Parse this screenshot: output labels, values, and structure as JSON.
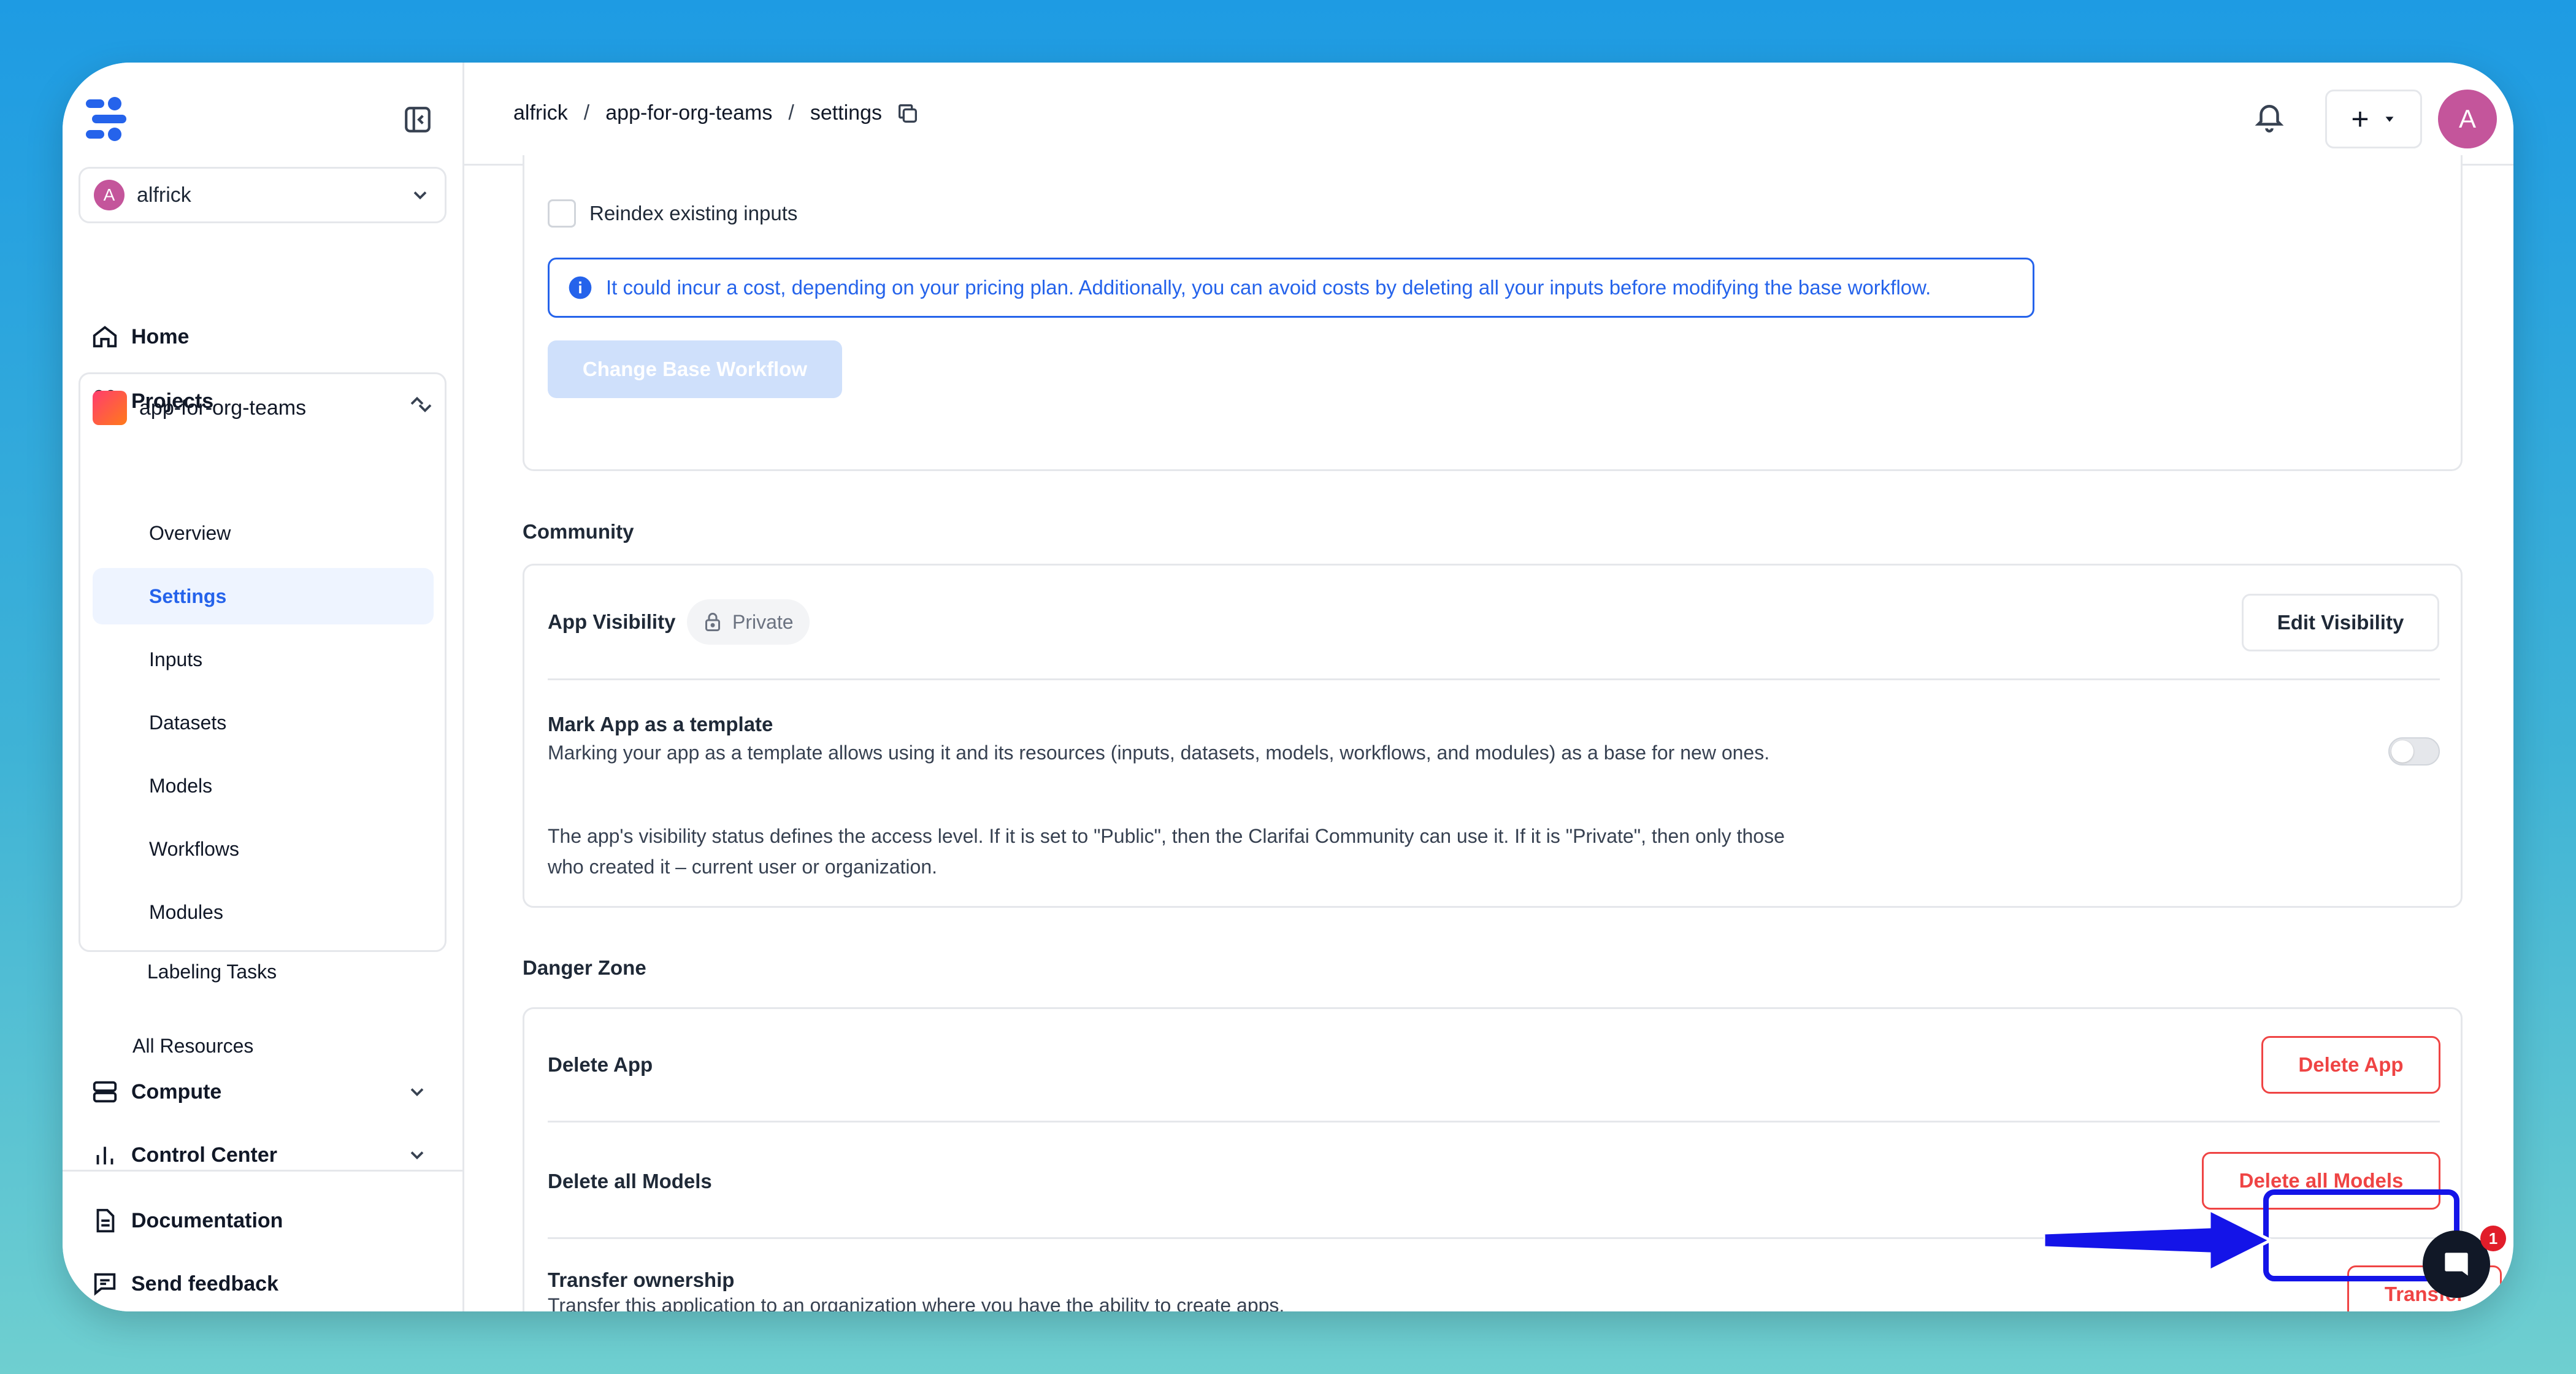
{
  "sidebar": {
    "org_name": "alfrick",
    "org_initial": "A",
    "home": "Home",
    "projects": "Projects",
    "project_name": "app-for-org-teams",
    "project_items": [
      "Overview",
      "Settings",
      "Inputs",
      "Datasets",
      "Models",
      "Workflows",
      "Modules",
      "Labeling Tasks"
    ],
    "active_item": "Settings",
    "all_resources": "All Resources",
    "compute": "Compute",
    "control_center": "Control Center",
    "documentation": "Documentation",
    "send_feedback": "Send feedback"
  },
  "header": {
    "breadcrumbs": [
      "alfrick",
      "app-for-org-teams",
      "settings"
    ],
    "separator": "/",
    "user_initial": "A",
    "plus": "+"
  },
  "base_workflow": {
    "reindex_label": "Reindex existing inputs",
    "info_text": "It could incur a cost, depending on your pricing plan. Additionally, you can avoid costs by deleting all your inputs before modifying the base workflow.",
    "change_button": "Change Base Workflow"
  },
  "community": {
    "title": "Community",
    "visibility_label": "App Visibility",
    "visibility_value": "Private",
    "edit_visibility": "Edit Visibility",
    "template_label": "Mark App as a template",
    "template_desc": "Marking your app as a template allows using it and its resources (inputs, datasets, models, workflows, and modules) as a base for new ones.",
    "visibility_desc": "The app's visibility status defines the access level. If it is set to \"Public\", then the Clarifai Community can use it. If it is \"Private\", then only those who created it – current user or organization.",
    "template_enabled": false
  },
  "danger": {
    "title": "Danger Zone",
    "delete_app_label": "Delete App",
    "delete_app_button": "Delete App",
    "delete_models_label": "Delete all Models",
    "delete_models_button": "Delete all Models",
    "transfer_label": "Transfer ownership",
    "transfer_desc": "Transfer this application to an organization where you have the ability to create apps.",
    "transfer_button": "Transfer"
  },
  "chat": {
    "badge_count": "1"
  },
  "colors": {
    "accent": "#2563eb",
    "danger": "#ef4444",
    "highlight": "#1414e8",
    "avatar": "#c4559b"
  }
}
